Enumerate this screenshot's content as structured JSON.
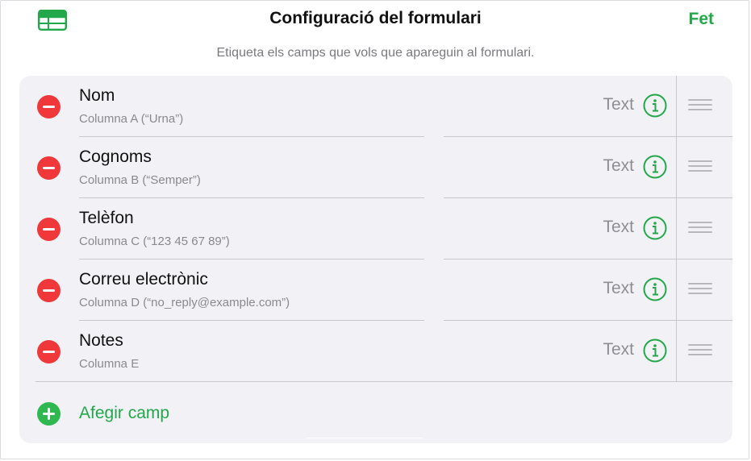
{
  "header": {
    "title": "Configuració del formulari",
    "done_label": "Fet",
    "left_icon": "table-icon",
    "accent_color": "#22a84a"
  },
  "subtitle": "Etiqueta els camps que vols que apareguin al formulari.",
  "fields": [
    {
      "name": "Nom",
      "column": "Columna A (“Urna”)",
      "type": "Text"
    },
    {
      "name": "Cognoms",
      "column": "Columna B (“Semper”)",
      "type": "Text"
    },
    {
      "name": "Telèfon",
      "column": "Columna C (“123 45 67 89”)",
      "type": "Text"
    },
    {
      "name": "Correu electrònic",
      "column": "Columna D (“no_reply@example.com”)",
      "type": "Text"
    },
    {
      "name": "Notes",
      "column": "Columna E",
      "type": "Text"
    }
  ],
  "add_field_label": "Afegir camp",
  "colors": {
    "delete": "#f0383b",
    "add": "#2fb84f",
    "card_bg": "#f1f1f6"
  }
}
